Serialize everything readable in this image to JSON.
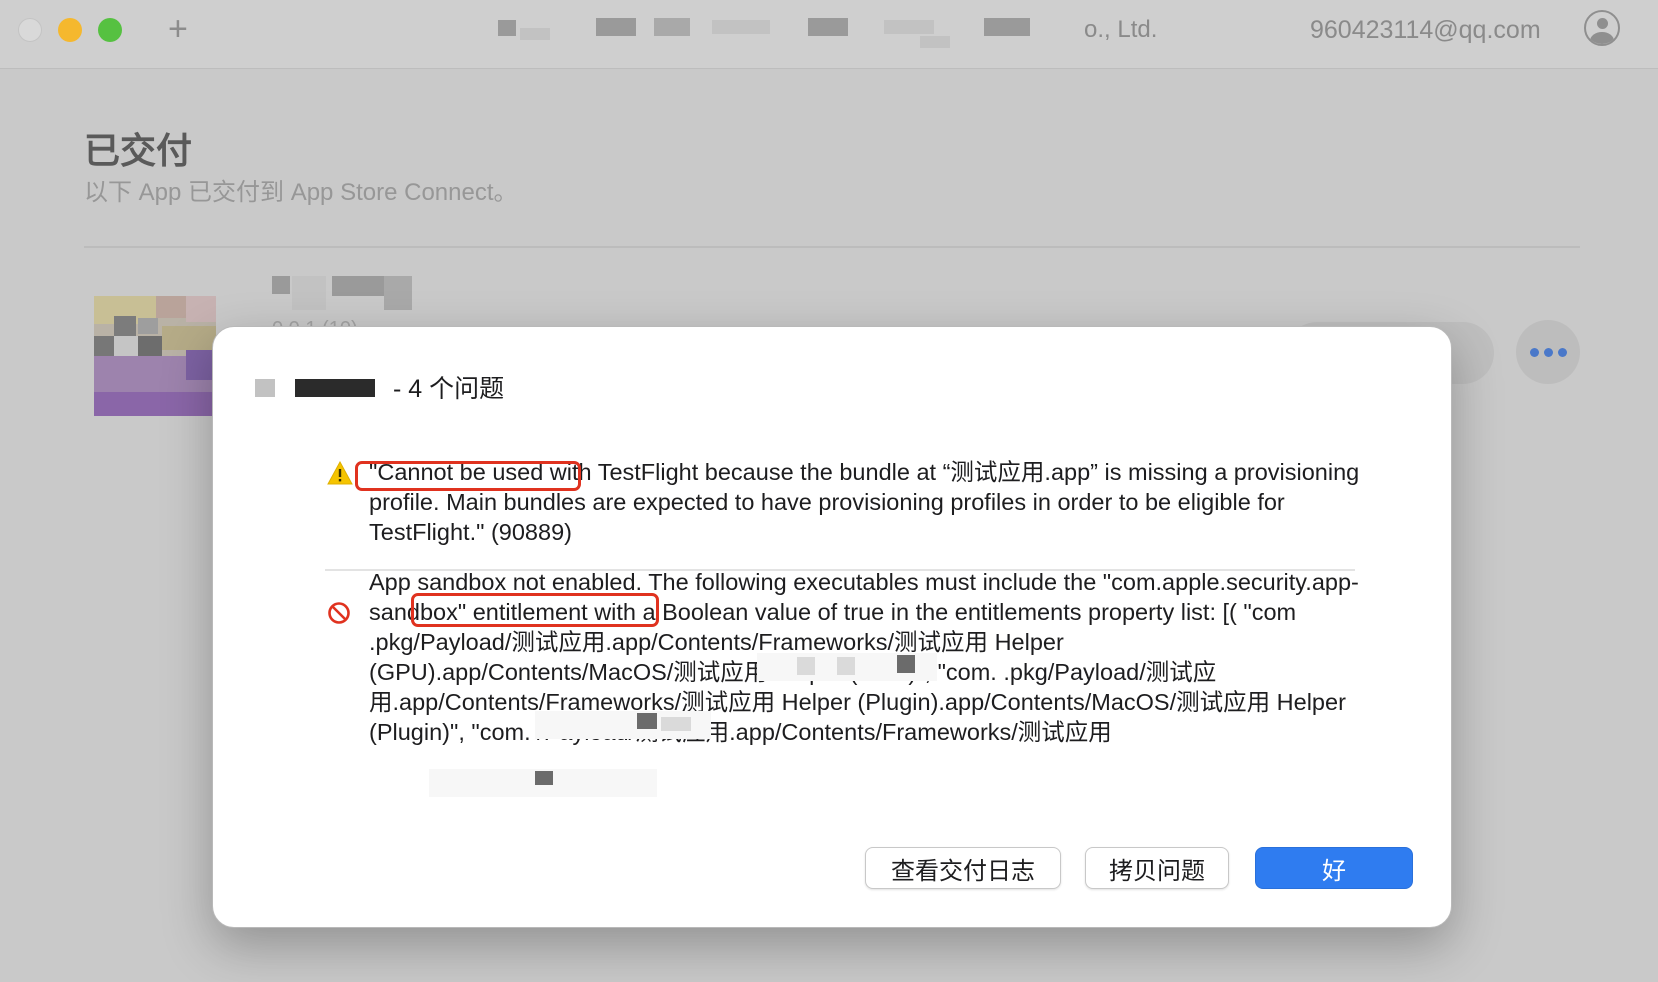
{
  "window": {
    "company_suffix": "o., Ltd.",
    "account": "960423114@qq.com"
  },
  "page": {
    "title": "已交付",
    "subtitle": "以下 App 已交付到 App Store Connect。",
    "version": "0.0.1 (10)"
  },
  "dialog": {
    "title_suffix": "- 4 个问题",
    "issues": [
      {
        "severity": "warning",
        "text_before": "\"Cannot be used with TestFlight because the bundle at “测试应用.app” is missing a ",
        "highlight": "provisioning profile.",
        "text_after": " Main bundles are expected to have provisioning profiles in order to be eligible for TestFlight.\" (90889)"
      },
      {
        "severity": "error",
        "text_before": "App ",
        "highlight": "sandbox not enabled.",
        "text_after": " The following executables must include the \"com.apple.security.app-sandbox\" entitlement with a Boolean value of true in the entitlements property list: [( \"com              .pkg/Payload/测试应用.app/Contents/Frameworks/测试应用 Helper (GPU).app/Contents/MacOS/测试应用 Helper (GPU)\", \"com.               .pkg/Payload/测试应用.app/Contents/Frameworks/测试应用 Helper (Plugin).app/Contents/MacOS/测试应用 Helper (Plugin)\", \"com.                     /Payload/测试应用.app/Contents/Frameworks/测试应用"
      }
    ],
    "buttons": {
      "view_log": "查看交付日志",
      "copy_issues": "拷贝问题",
      "ok": "好"
    }
  },
  "colors": {
    "primary_button": "#2f7cf0",
    "highlight_border": "#e0321f",
    "warning_icon": "#f5c400",
    "error_icon": "#e0321f"
  },
  "icons": [
    "plus-icon",
    "account-icon",
    "more-icon",
    "warning-icon",
    "prohibited-icon"
  ]
}
